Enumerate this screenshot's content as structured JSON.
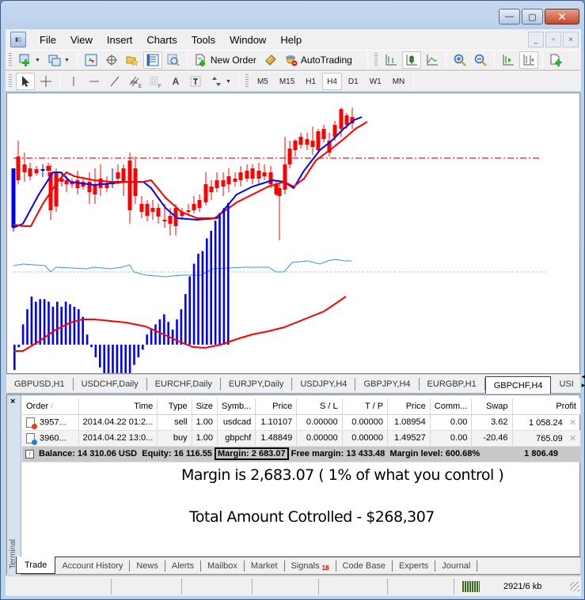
{
  "window": {
    "controls": {
      "minimize": "—",
      "maximize": "▢",
      "close": "✕"
    }
  },
  "menubar": {
    "app_icon": "mt4-icon",
    "items": [
      "File",
      "View",
      "Insert",
      "Charts",
      "Tools",
      "Window",
      "Help"
    ],
    "mdi_controls": {
      "minimize": "_",
      "restore": "▫",
      "close": "×"
    }
  },
  "toolbar1": {
    "new_order_label": "New Order",
    "autotrading_label": "AutoTrading"
  },
  "toolbar2": {
    "timeframes": [
      "M5",
      "M15",
      "H1",
      "H4",
      "D1",
      "W1",
      "MN"
    ],
    "active_timeframe": "H4",
    "text_tool": "A"
  },
  "chart": {
    "symbol": "GBPCHF,H4",
    "colors": {
      "bull": "#0000ff",
      "bear": "#ff0000",
      "ma_fast": "#0000ff",
      "ma_slow": "#ff0000",
      "level": "#e02020",
      "rsi": "#3399dd",
      "macd_hist": "#0000ff",
      "macd_signal": "#ff0000"
    }
  },
  "chart_tabs": {
    "tabs": [
      "GBPUSD,H1",
      "USDCHF,Daily",
      "EURCHF,Daily",
      "EURJPY,Daily",
      "USDJPY,H4",
      "GBPJPY,H4",
      "EURGBP,H1",
      "GBPCHF,H4",
      "USI"
    ],
    "active": "GBPCHF,H4",
    "nav_left": "◂",
    "nav_right": "▸"
  },
  "terminal": {
    "side_label": "Terminal",
    "close": "×",
    "columns": [
      "Order",
      "Time",
      "Type",
      "Size",
      "Symb...",
      "Price",
      "S / L",
      "T / P",
      "Price",
      "Comm...",
      "Swap",
      "Profit"
    ],
    "sort_indicator": "/",
    "rows": [
      {
        "order": "3957...",
        "time": "2014.04.22 01:2...",
        "type": "sell",
        "size": "1.00",
        "symbol": "usdcad",
        "price_open": "1.10107",
        "sl": "0.00000",
        "tp": "0.00000",
        "price_current": "1.08954",
        "commission": "0.00",
        "swap": "3.62",
        "profit": "1 058.24",
        "icon_color": "#e04020"
      },
      {
        "order": "3960...",
        "time": "2014.04.22 13:0...",
        "type": "buy",
        "size": "1.00",
        "symbol": "gbpchf",
        "price_open": "1.48849",
        "sl": "0.00000",
        "tp": "0.00000",
        "price_current": "1.49527",
        "commission": "0.00",
        "swap": "-20.46",
        "profit": "765.09",
        "icon_color": "#2a7ad8"
      }
    ],
    "summary": {
      "balance": "Balance: 14 310.06 USD",
      "equity": "Equity: 16 116.55",
      "margin": "Margin: 2 683.07",
      "free_margin": "Free margin: 13 433.48",
      "margin_level": "Margin level: 600.68%",
      "total_profit": "1 806.49"
    },
    "annotation_1": "Margin is 2,683.07   ( 1% of what you control )",
    "annotation_2": "Total Amount Cotrolled - $268,307",
    "tabs": [
      "Trade",
      "Account History",
      "News",
      "Alerts",
      "Mailbox",
      "Market",
      "Signals",
      "Code Base",
      "Experts",
      "Journal"
    ],
    "active_tab": "Trade",
    "signals_badge": "18"
  },
  "statusbar": {
    "traffic": "2921/6 kb"
  }
}
